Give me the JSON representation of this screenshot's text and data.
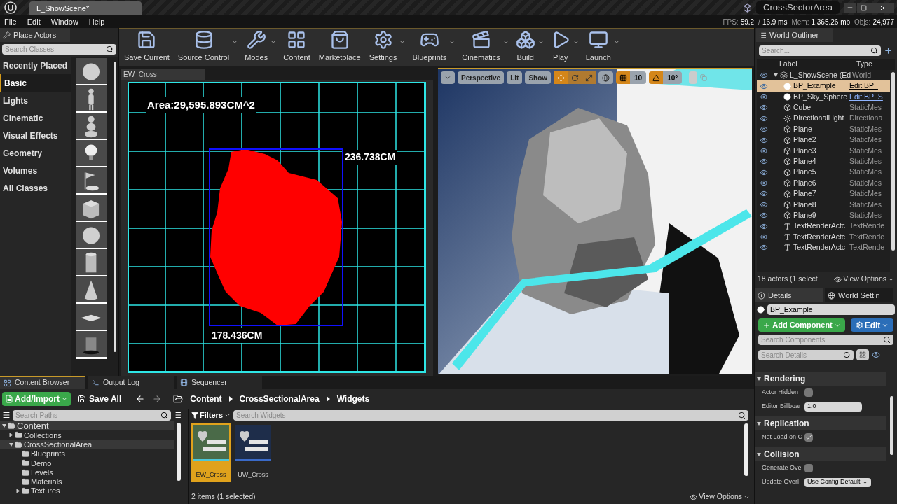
{
  "title_bar": {
    "document_tab": "L_ShowScene*",
    "project": "CrossSectorArea"
  },
  "menu": [
    "File",
    "Edit",
    "Window",
    "Help"
  ],
  "stats": [
    {
      "label": "FPS:",
      "value": "59.2"
    },
    {
      "label": "/",
      "value": "16.9 ms"
    },
    {
      "label": "Mem:",
      "value": "1,365.26 mb"
    },
    {
      "label": "Objs:",
      "value": "24,977"
    }
  ],
  "place_actors": {
    "tab": "Place Actors",
    "search_placeholder": "Search Classes",
    "categories": [
      {
        "label": "Recently Placed",
        "selected": false
      },
      {
        "label": "Basic",
        "selected": true
      },
      {
        "label": "Lights",
        "selected": false
      },
      {
        "label": "Cinematic",
        "selected": false
      },
      {
        "label": "Visual Effects",
        "selected": false
      },
      {
        "label": "Geometry",
        "selected": false
      },
      {
        "label": "Volumes",
        "selected": false
      },
      {
        "label": "All Classes",
        "selected": false
      }
    ],
    "items": [
      {
        "kind": "sphere"
      },
      {
        "kind": "figure"
      },
      {
        "kind": "pawn"
      },
      {
        "kind": "bulb"
      },
      {
        "kind": "flag"
      },
      {
        "kind": "cube"
      },
      {
        "kind": "sphere"
      },
      {
        "kind": "cylinder"
      },
      {
        "kind": "cone"
      },
      {
        "kind": "plane"
      },
      {
        "kind": "trigger"
      }
    ]
  },
  "toolbar": [
    {
      "label": "Save Current",
      "kind": "save",
      "dropdown": false
    },
    {
      "label": "Source Control",
      "kind": "source",
      "dropdown": true
    },
    {
      "label": "Modes",
      "kind": "modes",
      "dropdown": true
    },
    {
      "label": "Content",
      "kind": "content",
      "dropdown": false
    },
    {
      "label": "Marketplace",
      "kind": "market",
      "dropdown": false
    },
    {
      "label": "Settings",
      "kind": "settings",
      "dropdown": true
    },
    {
      "label": "Blueprints",
      "kind": "blueprints",
      "dropdown": true
    },
    {
      "label": "Cinematics",
      "kind": "cinematics",
      "dropdown": true
    },
    {
      "label": "Build",
      "kind": "build",
      "dropdown": true
    },
    {
      "label": "Play",
      "kind": "play",
      "dropdown": true
    },
    {
      "label": "Launch",
      "kind": "launch",
      "dropdown": true
    }
  ],
  "widget_viewport": {
    "tab": "EW_Cross",
    "area_label": "Area:29,595.893CM^2",
    "height_label": "236.738CM",
    "width_label": "178.436CM"
  },
  "perspective_viewport": {
    "view_mode": "Perspective",
    "lighting": "Lit",
    "show": "Show",
    "transform_tools": [
      {
        "kind": "translate",
        "selected": true
      },
      {
        "kind": "rotate",
        "selected": false
      },
      {
        "kind": "scale",
        "selected": false
      }
    ],
    "grid_snap_on": true,
    "grid_snap": "10",
    "rotation_snap_on": true,
    "rotation_snap": "10°"
  },
  "world_outliner": {
    "tab": "World Outliner",
    "search_placeholder": "Search...",
    "columns": [
      "Label",
      "Type"
    ],
    "rows": [
      {
        "label": "L_ShowScene (Ed",
        "type": "World",
        "kind": "level",
        "selected": false,
        "link": false,
        "expanded": true,
        "children": [
          {
            "label": "BP_Example",
            "type": "Edit BP_",
            "kind": "blueprint",
            "selected": true,
            "link": true
          },
          {
            "label": "BP_Sky_Sphere",
            "type": "Edit BP_S",
            "kind": "sphere",
            "selected": false,
            "link": true
          },
          {
            "label": "Cube",
            "type": "StaticMes",
            "kind": "mesh",
            "selected": false,
            "link": false
          },
          {
            "label": "DirectionalLight",
            "type": "Directiona",
            "kind": "light",
            "selected": false,
            "link": false
          },
          {
            "label": "Plane",
            "type": "StaticMes",
            "kind": "mesh",
            "selected": false,
            "link": false
          },
          {
            "label": "Plane2",
            "type": "StaticMes",
            "kind": "mesh",
            "selected": false,
            "link": false
          },
          {
            "label": "Plane3",
            "type": "StaticMes",
            "kind": "mesh",
            "selected": false,
            "link": false
          },
          {
            "label": "Plane4",
            "type": "StaticMes",
            "kind": "mesh",
            "selected": false,
            "link": false
          },
          {
            "label": "Plane5",
            "type": "StaticMes",
            "kind": "mesh",
            "selected": false,
            "link": false
          },
          {
            "label": "Plane6",
            "type": "StaticMes",
            "kind": "mesh",
            "selected": false,
            "link": false
          },
          {
            "label": "Plane7",
            "type": "StaticMes",
            "kind": "mesh",
            "selected": false,
            "link": false
          },
          {
            "label": "Plane8",
            "type": "StaticMes",
            "kind": "mesh",
            "selected": false,
            "link": false
          },
          {
            "label": "Plane9",
            "type": "StaticMes",
            "kind": "mesh",
            "selected": false,
            "link": false
          },
          {
            "label": "TextRenderActc",
            "type": "TextRende",
            "kind": "text",
            "selected": false,
            "link": false
          },
          {
            "label": "TextRenderActc",
            "type": "TextRende",
            "kind": "text",
            "selected": false,
            "link": false
          },
          {
            "label": "TextRenderActc",
            "type": "TextRende",
            "kind": "text",
            "selected": false,
            "link": false
          }
        ]
      }
    ],
    "count": "18 actors (1 select",
    "view_options": "View Options"
  },
  "details": {
    "tabs": [
      {
        "label": "Details",
        "selected": true
      },
      {
        "label": "World Settin",
        "selected": false
      }
    ],
    "name": "BP_Example",
    "add_component": "Add Component",
    "edit": "Edit",
    "search_components": "Search Components",
    "search_details": "Search Details",
    "sections": [
      {
        "title": "Rendering",
        "expanded": true,
        "properties": [
          {
            "label": "Actor Hidden",
            "kind": "checkbox",
            "checked": false
          },
          {
            "label": "Editor Billboar",
            "kind": "number",
            "value": "1.0"
          }
        ]
      },
      {
        "title": "Replication",
        "expanded": true,
        "properties": [
          {
            "label": "Net Load on C",
            "kind": "checkbox",
            "checked": true
          }
        ]
      },
      {
        "title": "Collision",
        "expanded": true,
        "properties": [
          {
            "label": "Generate Ove",
            "kind": "checkbox",
            "checked": false
          },
          {
            "label": "Update Overl",
            "kind": "dropdown",
            "value": "Use Config Default"
          }
        ]
      }
    ]
  },
  "content_browser": {
    "tabs": [
      {
        "label": "Content Browser",
        "kind": "browser",
        "selected": true
      },
      {
        "label": "Output Log",
        "kind": "log",
        "selected": false
      },
      {
        "label": "Sequencer",
        "kind": "sequencer",
        "selected": false
      }
    ],
    "add_import": "Add/Import",
    "save_all": "Save All",
    "breadcrumbs": [
      "Content",
      "CrossSectionalArea",
      "Widgets"
    ],
    "search_paths": "Search Paths",
    "tree": [
      {
        "label": "Content",
        "expanded": true,
        "selected": true,
        "children": [
          {
            "label": "Collections",
            "expanded": false,
            "selected": false
          },
          {
            "label": "CrossSectionalArea",
            "expanded": true,
            "selected": true,
            "children": [
              {
                "label": "Blueprints",
                "selected": false
              },
              {
                "label": "Demo",
                "selected": false
              },
              {
                "label": "Levels",
                "selected": false
              },
              {
                "label": "Materials",
                "selected": false
              },
              {
                "label": "Textures",
                "expanded": false,
                "selected": false
              }
            ]
          }
        ]
      }
    ],
    "filters": "Filters",
    "search_widgets": "Search Widgets",
    "assets": [
      {
        "name": "EW_Cross",
        "selected": true,
        "color": "#4a6a48"
      },
      {
        "name": "UW_Cross",
        "selected": false,
        "color": "#1e2d4a"
      }
    ],
    "status": "2 items (1 selected)",
    "view_options": "View Options"
  }
}
